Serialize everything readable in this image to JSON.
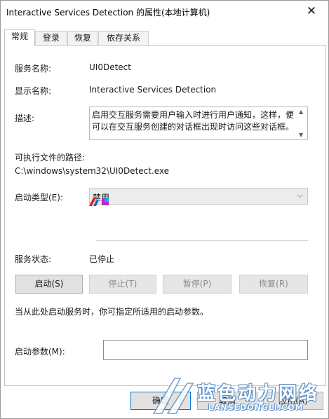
{
  "window": {
    "title": "Interactive Services Detection 的属性(本地计算机)",
    "close_glyph": "✕"
  },
  "tabs": [
    {
      "label": "常规",
      "active": true
    },
    {
      "label": "登录",
      "active": false
    },
    {
      "label": "恢复",
      "active": false
    },
    {
      "label": "依存关系",
      "active": false
    }
  ],
  "general": {
    "service_name_label": "服务名称:",
    "service_name_value": "UI0Detect",
    "display_name_label": "显示名称:",
    "display_name_value": "Interactive Services Detection",
    "description_label": "描述:",
    "description_value": "启用交互服务需要用户输入时进行用户通知，这样，便可以在交互服务创建的对话框出现时访问这些对话框。",
    "exe_path_label": "可执行文件的路径:",
    "exe_path_value": "C:\\windows\\system32\\UI0Detect.exe",
    "startup_type_label": "启动类型(E):",
    "startup_type_value": "禁用",
    "service_status_label": "服务状态:",
    "service_status_value": "已停止",
    "hint_text": "当从此处启动服务时，你可指定所适用的启动参数。",
    "start_params_label": "启动参数(M):",
    "start_params_value": ""
  },
  "control_buttons": {
    "start": "启动(S)",
    "stop": "停止(T)",
    "pause": "暂停(P)",
    "resume": "恢复(R)"
  },
  "footer": {
    "ok": "确定",
    "cancel": "取消",
    "apply": "应用(A)"
  },
  "watermark": {
    "text": "蓝色动力网络",
    "sub": "LANSEDONGLI.COM"
  },
  "colors": {
    "accent": "#0078d7",
    "watermark_blue": "#5b8fc9"
  }
}
